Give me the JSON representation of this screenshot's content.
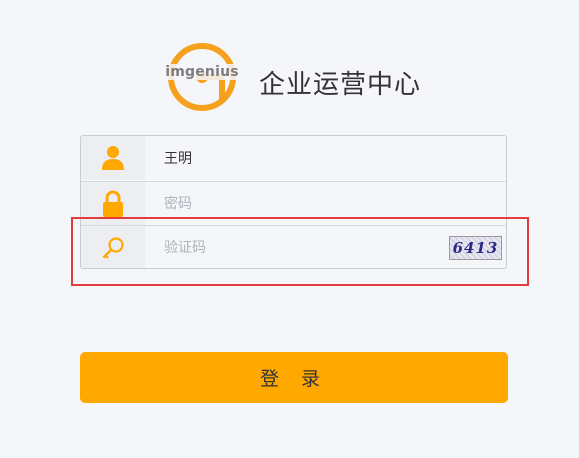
{
  "logo": {
    "text": "imgenius",
    "icon": "imgenius-g-logo"
  },
  "app_title": "企业运营中心",
  "form": {
    "username": {
      "value": "王明",
      "placeholder": "",
      "icon": "user-icon"
    },
    "password": {
      "value": "",
      "placeholder": "密码",
      "icon": "lock-icon"
    },
    "captcha": {
      "value": "",
      "placeholder": "验证码",
      "icon": "key-icon",
      "image_text": "6413"
    }
  },
  "login_button": {
    "label": "登 录"
  },
  "colors": {
    "accent": "#ffa800",
    "icon": "#ffa800",
    "highlight": "#e43c3c",
    "background": "#f5f6fa"
  }
}
